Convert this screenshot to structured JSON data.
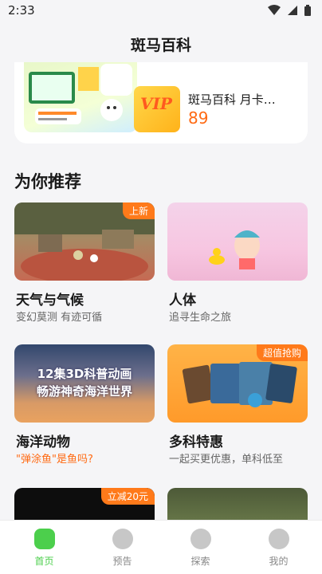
{
  "status": {
    "time": "2:33"
  },
  "header": {
    "title": "斑马百科"
  },
  "banner": {
    "product_name": "斑马百科 月卡…",
    "price": "89",
    "vip_text": "VIP"
  },
  "section": {
    "title": "为你推荐"
  },
  "cards": [
    {
      "title": "天气与气候",
      "subtitle": "变幻莫测 有迹可循",
      "badge": "上新"
    },
    {
      "title": "人体",
      "subtitle": "追寻生命之旅",
      "badge": ""
    },
    {
      "title": "海洋动物",
      "subtitle": "\"弹涂鱼\"是鱼吗?",
      "badge": "",
      "thumb_line1": "12集3D科普动画",
      "thumb_line2": "畅游神奇海洋世界"
    },
    {
      "title": "多科特惠",
      "subtitle": "一起买更优惠，单科低至",
      "badge": "超值抢购"
    },
    {
      "title": "",
      "subtitle": "",
      "badge": "立减20元"
    },
    {
      "title": "",
      "subtitle": "",
      "badge": ""
    }
  ],
  "tabs": [
    {
      "label": "首页",
      "icon": "home-icon",
      "active": true
    },
    {
      "label": "预告",
      "icon": "clock-icon",
      "active": false
    },
    {
      "label": "探索",
      "icon": "compass-icon",
      "active": false
    },
    {
      "label": "我的",
      "icon": "profile-icon",
      "active": false
    }
  ],
  "colors": {
    "accent": "#4ccf4c",
    "badge": "#ff7a1a",
    "price": "#ff6a13"
  }
}
